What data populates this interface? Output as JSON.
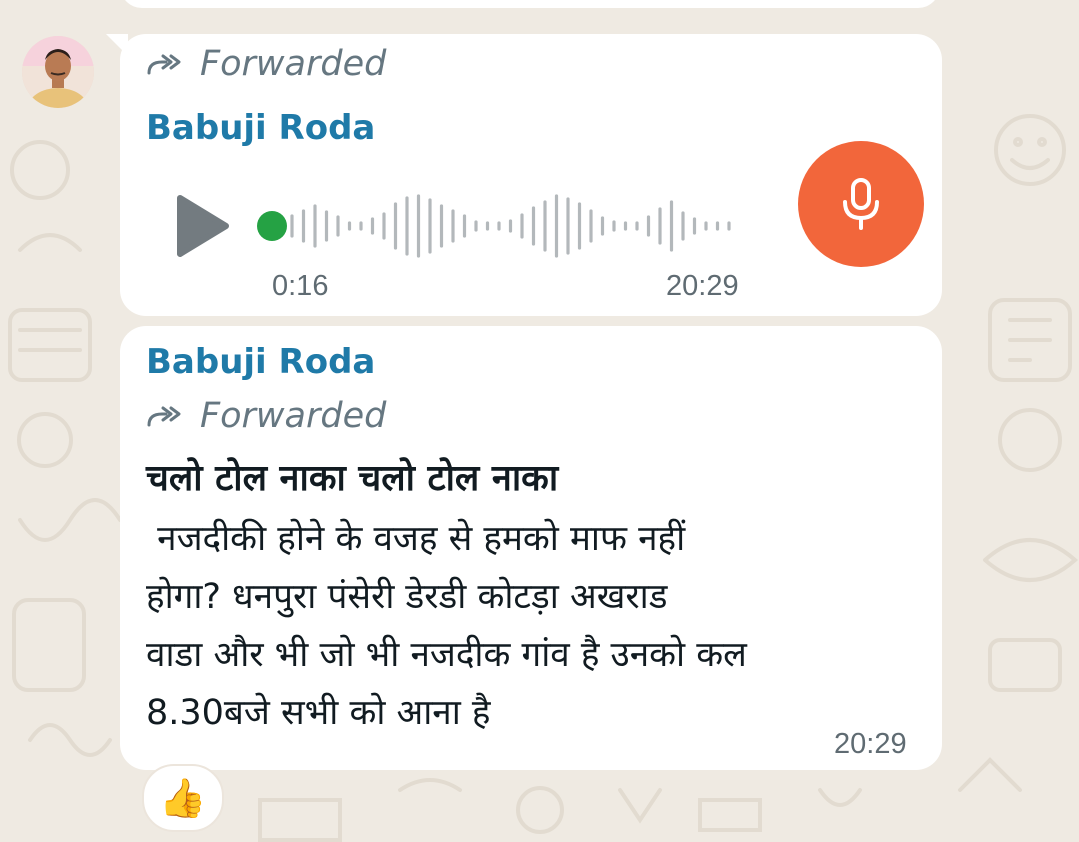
{
  "voice_message": {
    "forwarded_label": "Forwarded",
    "sender": "Babuji Roda",
    "duration": "0:16",
    "time": "20:29",
    "progress": 0.0,
    "play_icon": "play-icon",
    "mic_icon": "microphone-icon",
    "mic_color": "#f2663b",
    "progress_dot_color": "#25a244"
  },
  "text_message": {
    "sender": "Babuji Roda",
    "forwarded_label": "Forwarded",
    "title": "चलो टोल नाका चलो टोल नाका",
    "body": " नजदीकी होने के वजह से हमको माफ नहीं\nहोगा? धनपुरा पंसेरी डेरडी कोटड़ा अखराड\nवाडा और भी जो भी नजदीक गांव है उनको कल\n8.30बजे सभी को आना है",
    "time": "20:29"
  },
  "reaction": {
    "emoji": "👍",
    "icon": "thumbs-up-icon"
  },
  "colors": {
    "background": "#efeae2",
    "bubble": "#ffffff",
    "sender_name": "#1f7aa8",
    "meta_text": "#667781"
  }
}
